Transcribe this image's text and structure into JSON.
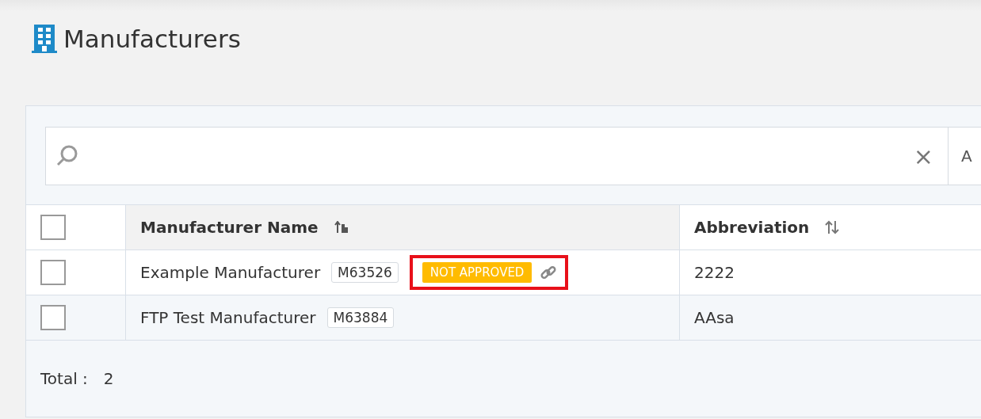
{
  "page": {
    "title": "Manufacturers"
  },
  "search": {
    "clear_label": "×",
    "button_label": "A"
  },
  "table": {
    "select_all": {
      "checked": false
    },
    "columns": [
      {
        "label": "Manufacturer Name",
        "sorted": true
      },
      {
        "label": "Abbreviation",
        "sorted": false
      }
    ],
    "rows": [
      {
        "checked": false,
        "name": "Example Manufacturer",
        "code": "M63526",
        "status": "NOT APPROVED",
        "linked": true,
        "highlighted": true,
        "abbreviation": "2222"
      },
      {
        "checked": false,
        "name": "FTP Test Manufacturer",
        "code": "M63884",
        "linked": false,
        "highlighted": false,
        "abbreviation": "AAsa"
      }
    ]
  },
  "footer": {
    "total_label": "Total :",
    "total": "2"
  }
}
